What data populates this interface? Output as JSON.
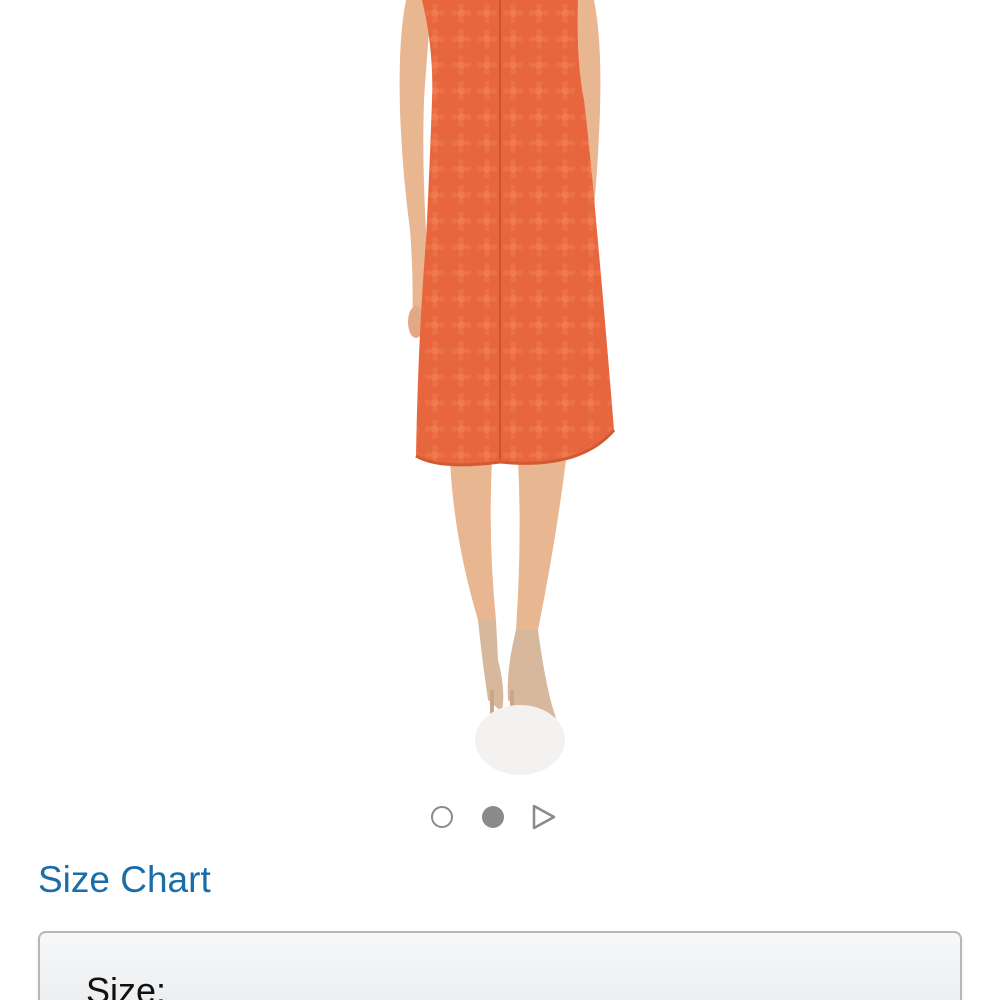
{
  "product": {
    "image": {
      "description_icon": "orange-lace-dress-back-view",
      "dress_color": "#e8663d",
      "skin_color": "#e9b692",
      "shoe_color": "#d8b89c"
    }
  },
  "carousel": {
    "total_dots": 2,
    "active_index": 1,
    "inactive_icon": "circle-outline-icon",
    "active_icon": "circle-filled-icon",
    "video_icon": "play-triangle-icon"
  },
  "size_chart": {
    "label": "Size Chart",
    "color": "#1a6da8"
  },
  "size_selector": {
    "label": "Size:"
  }
}
